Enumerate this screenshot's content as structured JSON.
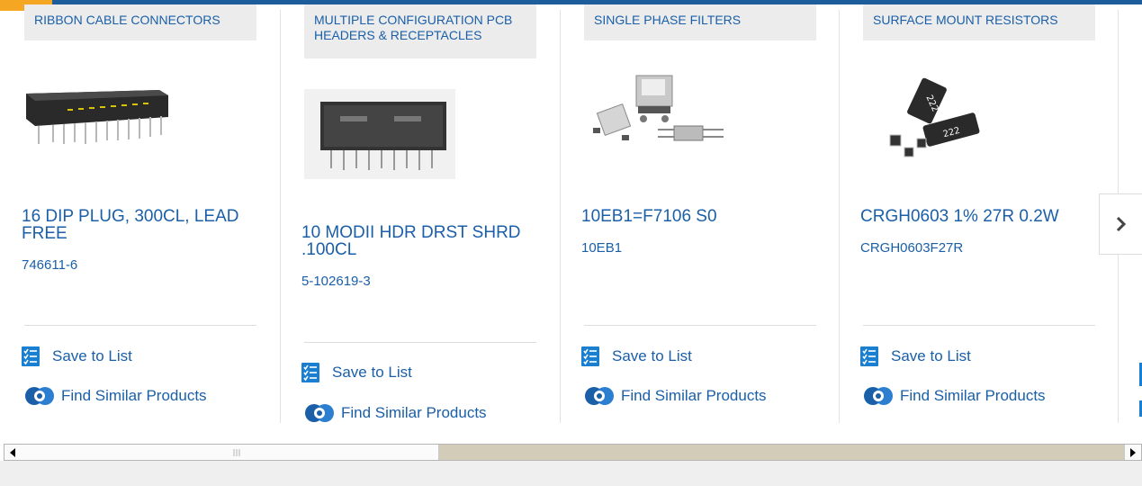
{
  "cards": [
    {
      "category": "RIBBON CABLE CONNECTORS",
      "name": "16 DIP PLUG, 300CL, LEAD FREE",
      "part_number": "746611-6",
      "save_label": "Save to List",
      "similar_label": "Find Similar Products"
    },
    {
      "category": "MULTIPLE CONFIGURATION PCB HEADERS & RECEPTACLES",
      "name": "10 MODII HDR DRST SHRD .100CL",
      "part_number": "5-102619-3",
      "save_label": "Save to List",
      "similar_label": "Find Similar Products"
    },
    {
      "category": "SINGLE PHASE FILTERS",
      "name": "10EB1=F7106 S0",
      "part_number": "10EB1",
      "save_label": "Save to List",
      "similar_label": "Find Similar Products"
    },
    {
      "category": "SURFACE MOUNT RESISTORS",
      "name": "CRGH0603 1% 27R 0.2W",
      "part_number": "CRGH0603F27R",
      "save_label": "Save to List",
      "similar_label": "Find Similar Products"
    }
  ],
  "resistor_labels": [
    "222",
    "222"
  ],
  "next_button_icon": "chevron-right-icon",
  "colors": {
    "link": "#1a5fa8",
    "accent_orange": "#f5a623",
    "topbar_blue": "#1d5d9c",
    "category_bg": "#ececec"
  }
}
